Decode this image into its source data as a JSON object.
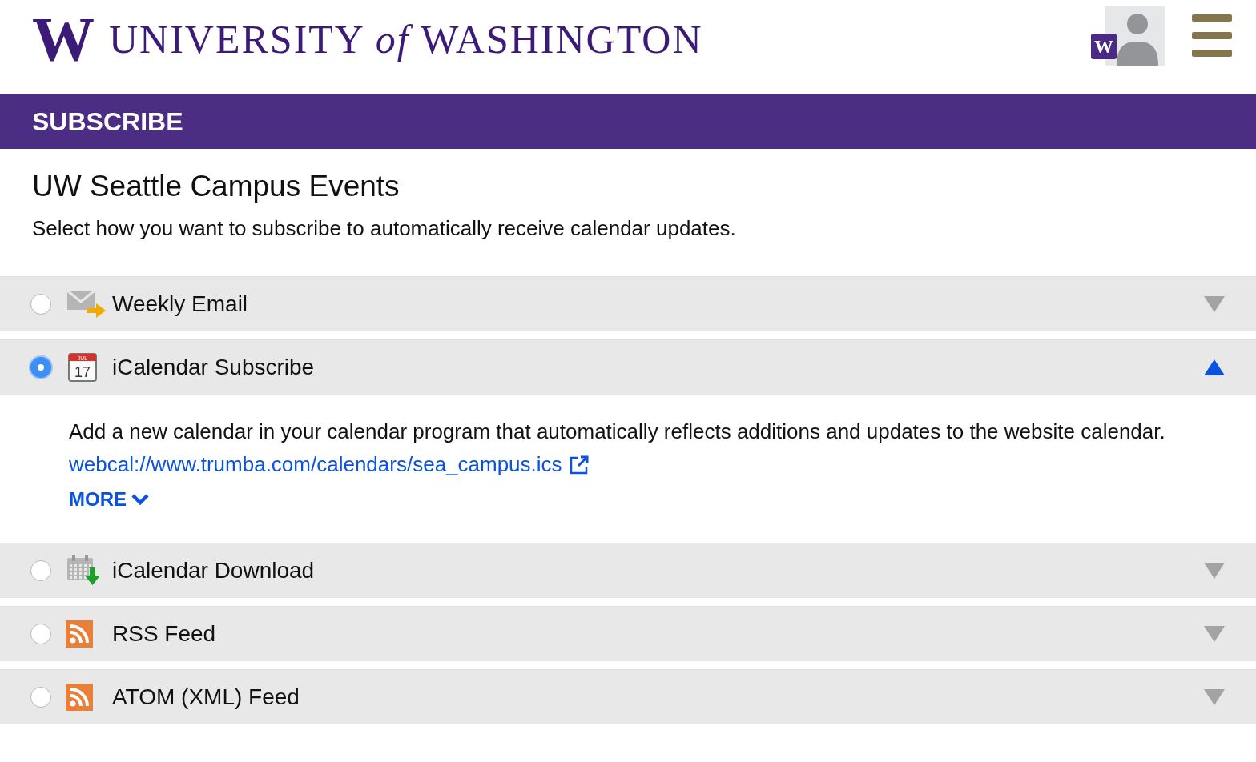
{
  "header": {
    "logo_mark": "W",
    "logo_text": "UNIVERSITY *of* WASHINGTON",
    "avatar_badge": "W"
  },
  "banner": {
    "title": "SUBSCRIBE"
  },
  "heading": "UW Seattle Campus Events",
  "intro": "Select how you want to subscribe to automatically receive calendar updates.",
  "options": [
    {
      "kind": "email",
      "label": "Weekly Email",
      "selected": false,
      "expanded": false
    },
    {
      "kind": "calendar",
      "label": "iCalendar Subscribe",
      "selected": true,
      "expanded": true,
      "description": "Add a new calendar in your calendar program that automatically reflects additions and updates to the website calendar.",
      "link": "webcal://www.trumba.com/calendars/sea_campus.ics",
      "more": "MORE",
      "calendar_month": "JUL",
      "calendar_day": "17"
    },
    {
      "kind": "download",
      "label": "iCalendar Download",
      "selected": false,
      "expanded": false
    },
    {
      "kind": "rss",
      "label": "RSS Feed",
      "selected": false,
      "expanded": false
    },
    {
      "kind": "rss",
      "label": "ATOM (XML) Feed",
      "selected": false,
      "expanded": false
    }
  ]
}
